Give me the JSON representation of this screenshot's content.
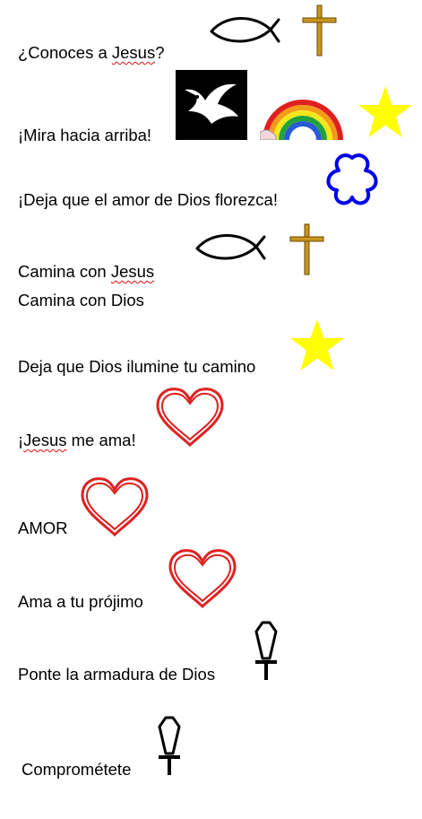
{
  "lines": {
    "l1_pre": "¿Conoces a ",
    "l1_word": "Jesus",
    "l1_post": "?",
    "l2": "¡Mira hacia arriba!",
    "l3": "¡Deja que el amor de Dios florezca!",
    "l4_pre": "Camina con ",
    "l4_word": "Jesus",
    "l5": "Camina con Dios",
    "l6": "Deja que Dios ilumine tu camino",
    "l7_pre": "¡",
    "l7_word": "Jesus",
    "l7_post": " me ama!",
    "l8": "AMOR",
    "l9": "Ama a tu prójimo",
    "l10": "Ponte la armadura de Dios",
    "l11": "Comprométete"
  },
  "colors": {
    "star": "#ffff00",
    "heart": "#e02020",
    "flower": "#0000ee",
    "cross": "#b8860b",
    "spellcheck": "#dd1111"
  },
  "icons": [
    "fish-icon",
    "cross-icon",
    "dove-icon",
    "rainbow-icon",
    "star-icon",
    "flower-icon",
    "heart-icon",
    "sword-icon"
  ]
}
